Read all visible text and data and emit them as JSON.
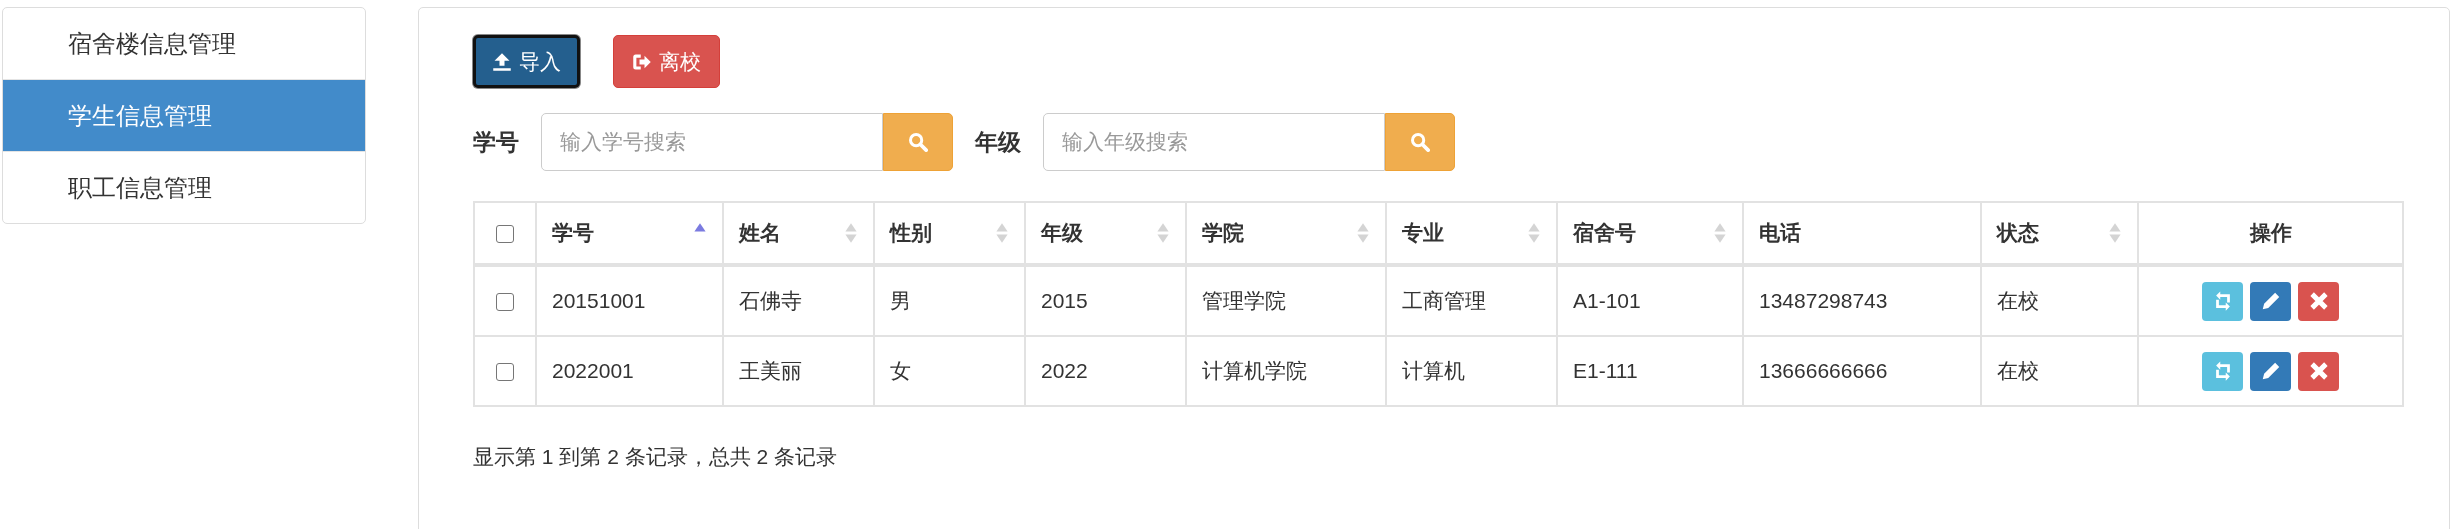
{
  "sidebar": {
    "items": [
      {
        "label": "宿舍楼信息管理",
        "selected": false
      },
      {
        "label": "学生信息管理",
        "selected": true
      },
      {
        "label": "职工信息管理",
        "selected": false
      }
    ]
  },
  "toolbar": {
    "buttons": [
      {
        "label": "导入",
        "kind": "import"
      },
      {
        "label": "离校",
        "kind": "leave"
      }
    ]
  },
  "search": [
    {
      "label": "学号",
      "placeholder": "输入学号搜索"
    },
    {
      "label": "年级",
      "placeholder": "输入年级搜索"
    }
  ],
  "table": {
    "select_all": {
      "checked": false
    },
    "columns": [
      {
        "label": "学号",
        "sortable": true,
        "sorted": true,
        "centered": false
      },
      {
        "label": "姓名",
        "sortable": true,
        "sorted": false,
        "centered": false
      },
      {
        "label": "性别",
        "sortable": true,
        "sorted": false,
        "centered": false
      },
      {
        "label": "年级",
        "sortable": true,
        "sorted": false,
        "centered": false
      },
      {
        "label": "学院",
        "sortable": true,
        "sorted": false,
        "centered": false
      },
      {
        "label": "专业",
        "sortable": true,
        "sorted": false,
        "centered": false
      },
      {
        "label": "宿舍号",
        "sortable": true,
        "sorted": false,
        "centered": false
      },
      {
        "label": "电话",
        "sortable": false,
        "centered": false
      },
      {
        "label": "状态",
        "sortable": true,
        "sorted": false,
        "centered": false
      },
      {
        "label": "操作",
        "sortable": false,
        "centered": true
      }
    ],
    "rows": [
      {
        "checked": false,
        "cells": [
          "20151001",
          "石佛寺",
          "男",
          "2015",
          "管理学院",
          "工商管理",
          "A1-101",
          "13487298743",
          "在校"
        ]
      },
      {
        "checked": false,
        "cells": [
          "2022001",
          "王美丽",
          "女",
          "2022",
          "计算机学院",
          "计算机",
          "E1-111",
          "13666666666",
          "在校"
        ]
      }
    ]
  },
  "footer": "显示第 1 到第 2 条记录，总共 2 条记录"
}
